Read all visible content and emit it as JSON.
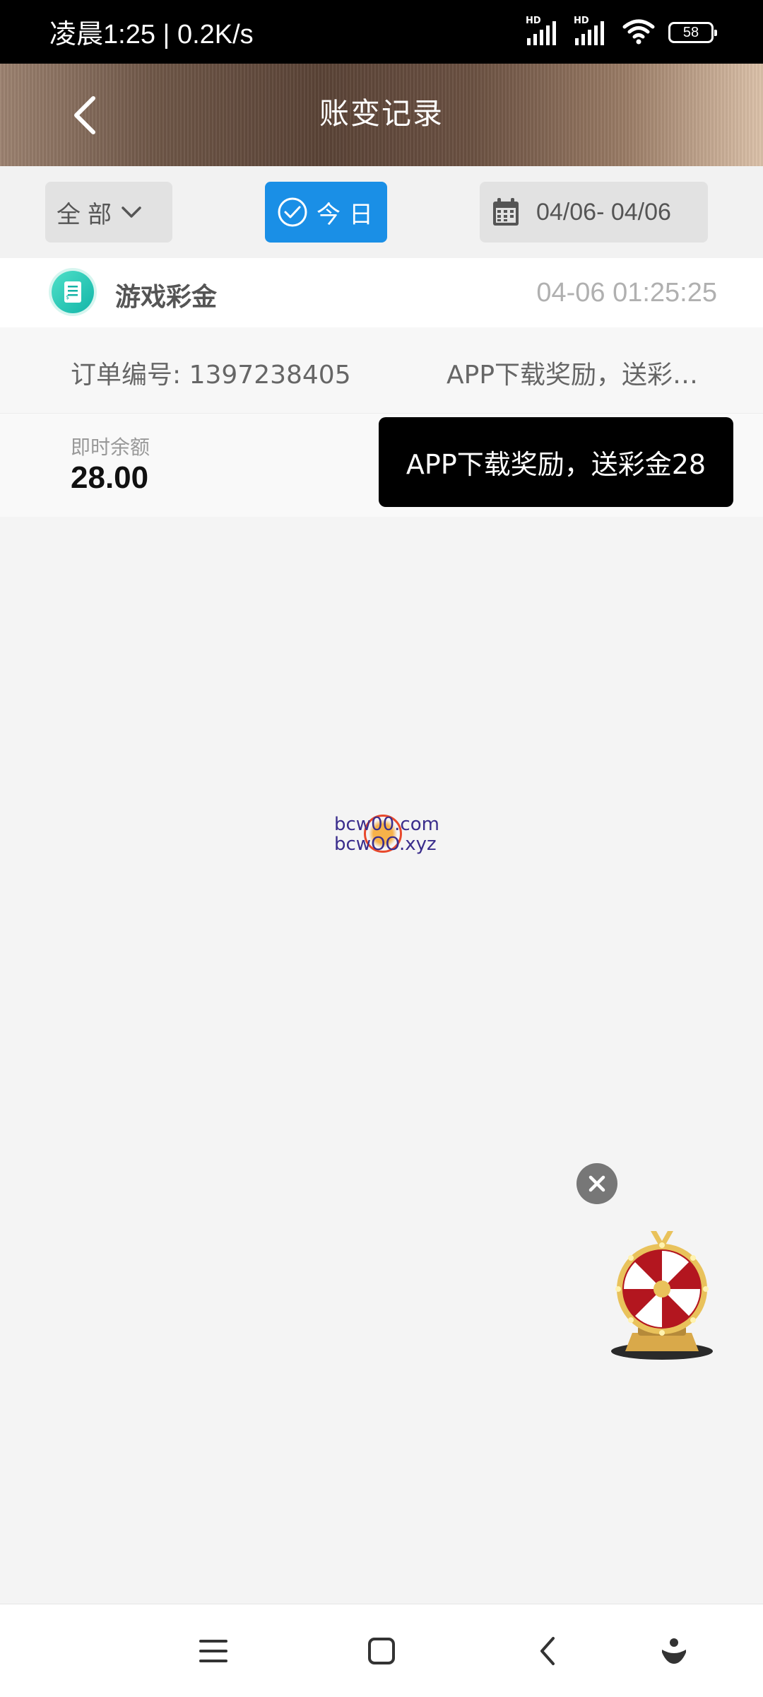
{
  "status_bar": {
    "time": "凌晨1:25 | 0.2K/s",
    "hd1": "HD",
    "hd2": "HD",
    "battery": "58"
  },
  "header": {
    "title": "账变记录"
  },
  "filters": {
    "category_label": "全部",
    "today_label": "今日",
    "date_range": "04/06- 04/06"
  },
  "record": {
    "icon": "receipt-icon",
    "title": "游戏彩金",
    "time": "04-06 01:25:25",
    "order_label": "订单编号: 1397238405",
    "description": "APP下载奖励，送彩金28",
    "balance_label": "即时余额",
    "balance_value": "28.00"
  },
  "toast": {
    "text": "APP下载奖励，送彩金28"
  },
  "watermark": {
    "line1": "bcw00.com",
    "line2": "bcwOO.xyz"
  },
  "floating": {
    "close_icon": "close-icon",
    "wheel_icon": "prize-wheel-icon"
  },
  "nav_bar": {
    "icons": [
      "menu-icon",
      "home-icon",
      "back-icon",
      "assistant-icon"
    ]
  },
  "colors": {
    "accent": "#1a8fe6",
    "status_bar": "#000000",
    "toast": "#000000",
    "background": "#f4f4f4"
  }
}
